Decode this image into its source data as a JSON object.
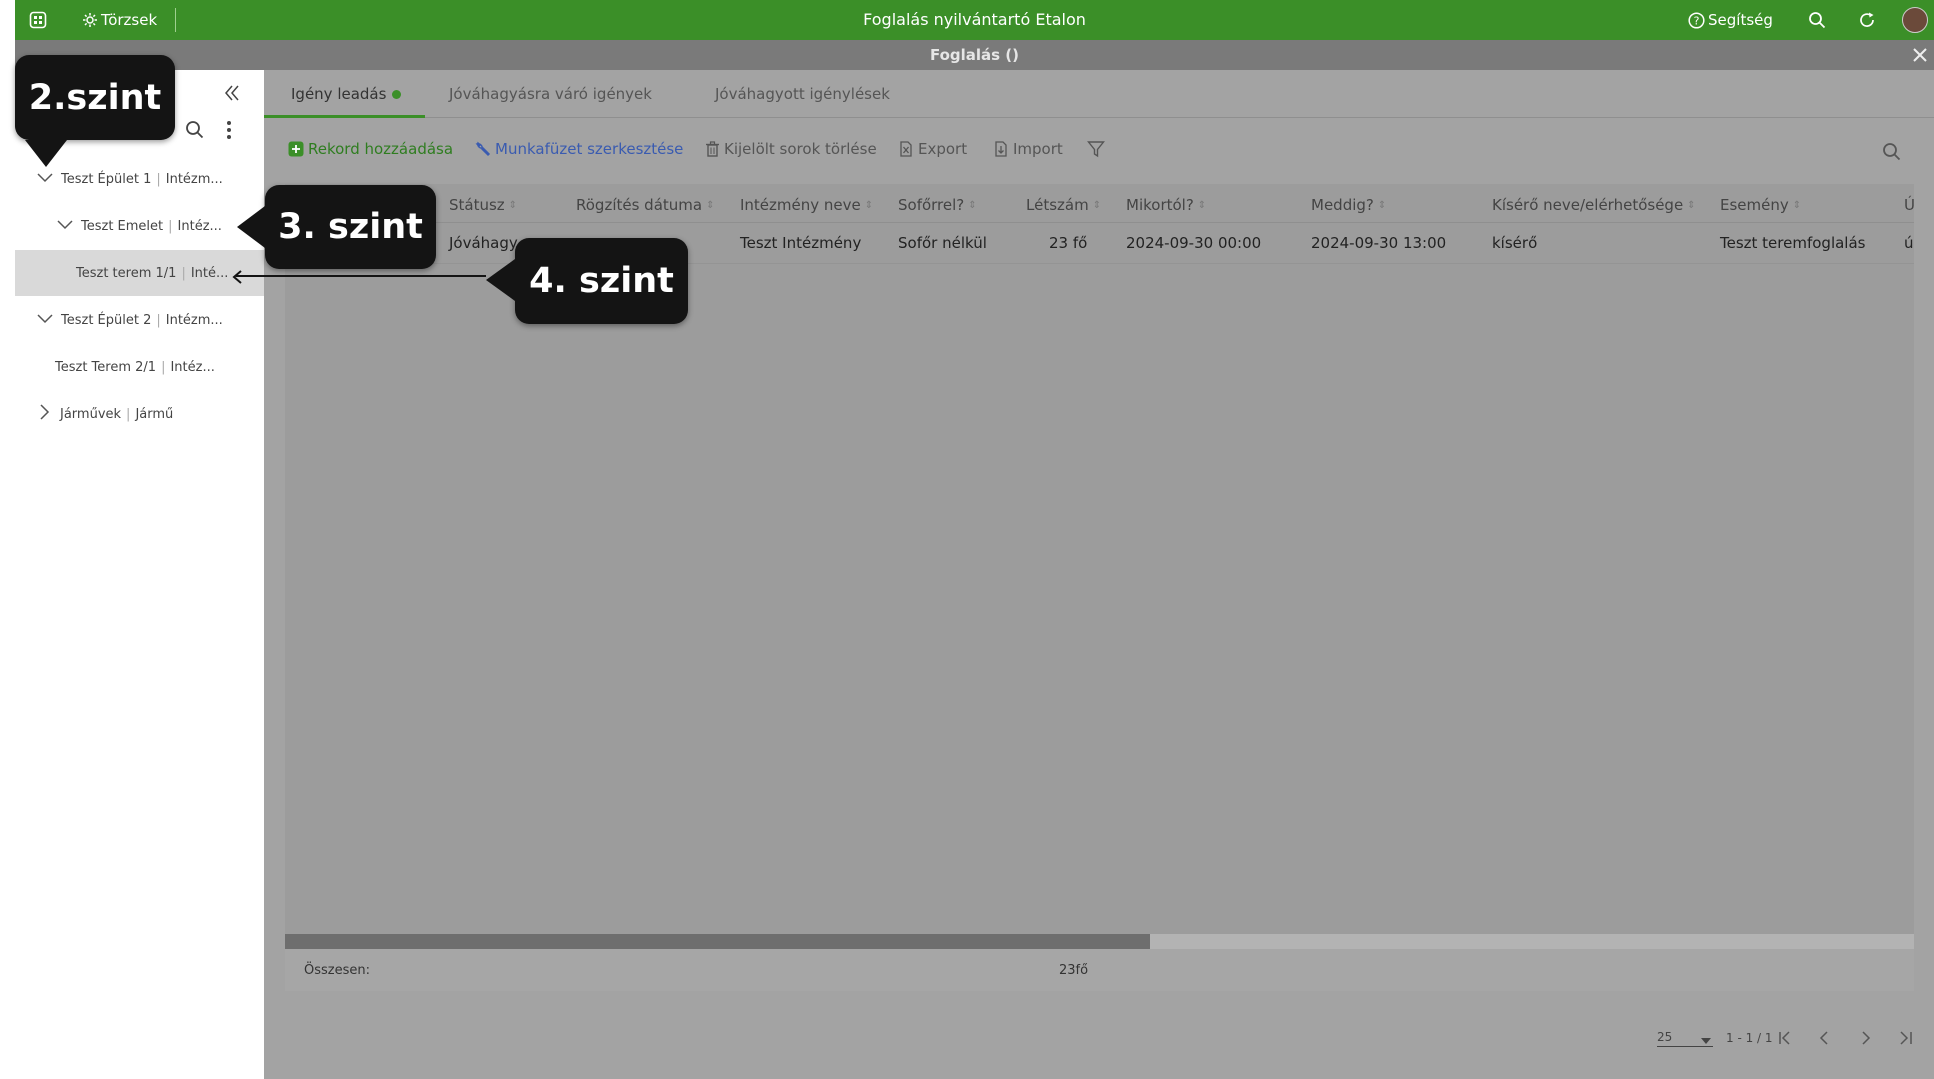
{
  "topbar": {
    "app_title": "Foglalás nyilvántartó Etalon",
    "torzsek_label": "Törzsek",
    "help_label": "Segítség",
    "bg_color": "#3b8f28"
  },
  "subbar": {
    "title": "Foglalás ()"
  },
  "tabs": [
    {
      "label": "Igény leadás"
    },
    {
      "label": "Jóváhagyásra váró igények"
    },
    {
      "label": "Jóváhagyott igénylések"
    }
  ],
  "toolbar": {
    "add_record": "Rekord hozzáadása",
    "edit_workbook": "Munkafüzet szerkesztése",
    "delete_selected": "Kijelölt sorok törlése",
    "export": "Export",
    "import": "Import"
  },
  "tree": {
    "items": [
      {
        "name": "Teszt Épület 1",
        "sub": "Intézm..."
      },
      {
        "name": "Teszt Emelet",
        "sub": "Intéz..."
      },
      {
        "name": "Teszt terem 1/1",
        "sub": "Inté..."
      },
      {
        "name": "Teszt Épület 2",
        "sub": "Intézm..."
      },
      {
        "name": "Teszt Terem 2/1",
        "sub": "Intéz..."
      },
      {
        "name": "Járművek",
        "sub": "Jármű"
      }
    ]
  },
  "table": {
    "columns": [
      "Státusz",
      "Rögzítés dátuma",
      "Intézmény neve",
      "Sofőrrel?",
      "Létszám",
      "Mikortól?",
      "Meddig?",
      "Kísérő neve/elérhetősége",
      "Esemény",
      "Ú"
    ],
    "row": [
      "Jóváhagy",
      "",
      "Teszt Intézmény",
      "Sofőr nélkül",
      "23 fő",
      "2024-09-30 00:00",
      "2024-09-30 13:00",
      "kísérő",
      "Teszt teremfoglalás",
      "ú"
    ]
  },
  "footer": {
    "total_label": "Összesen:",
    "total_value": "23fő"
  },
  "pagination": {
    "page_size": "25",
    "range": "1 - 1 / 1"
  },
  "callouts": {
    "level2": "2.szint",
    "level3": "3. szint",
    "level4": "4. szint"
  }
}
